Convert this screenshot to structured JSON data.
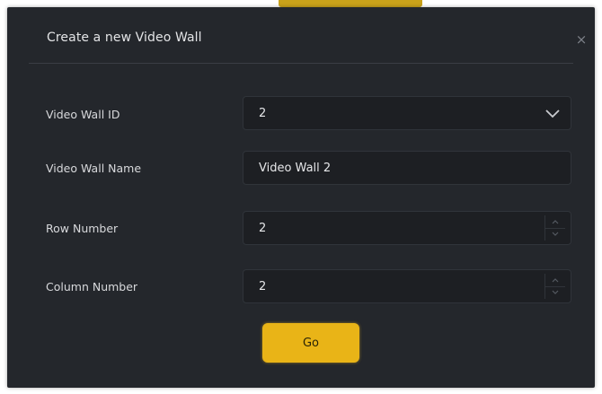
{
  "dialog": {
    "title": "Create a new Video Wall",
    "close_glyph": "×"
  },
  "fields": {
    "wall_id": {
      "label": "Video Wall ID",
      "value": "2",
      "icon": "chevron-down-icon"
    },
    "wall_name": {
      "label": "Video Wall Name",
      "value": "Video Wall 2"
    },
    "row_number": {
      "label": "Row Number",
      "value": "2"
    },
    "column_number": {
      "label": "Column Number",
      "value": "2"
    }
  },
  "actions": {
    "go_label": "Go"
  },
  "colors": {
    "dialog_bg": "#24272c",
    "input_bg": "#1d1f23",
    "accent": "#e9b417",
    "text": "#e3e4e6"
  }
}
